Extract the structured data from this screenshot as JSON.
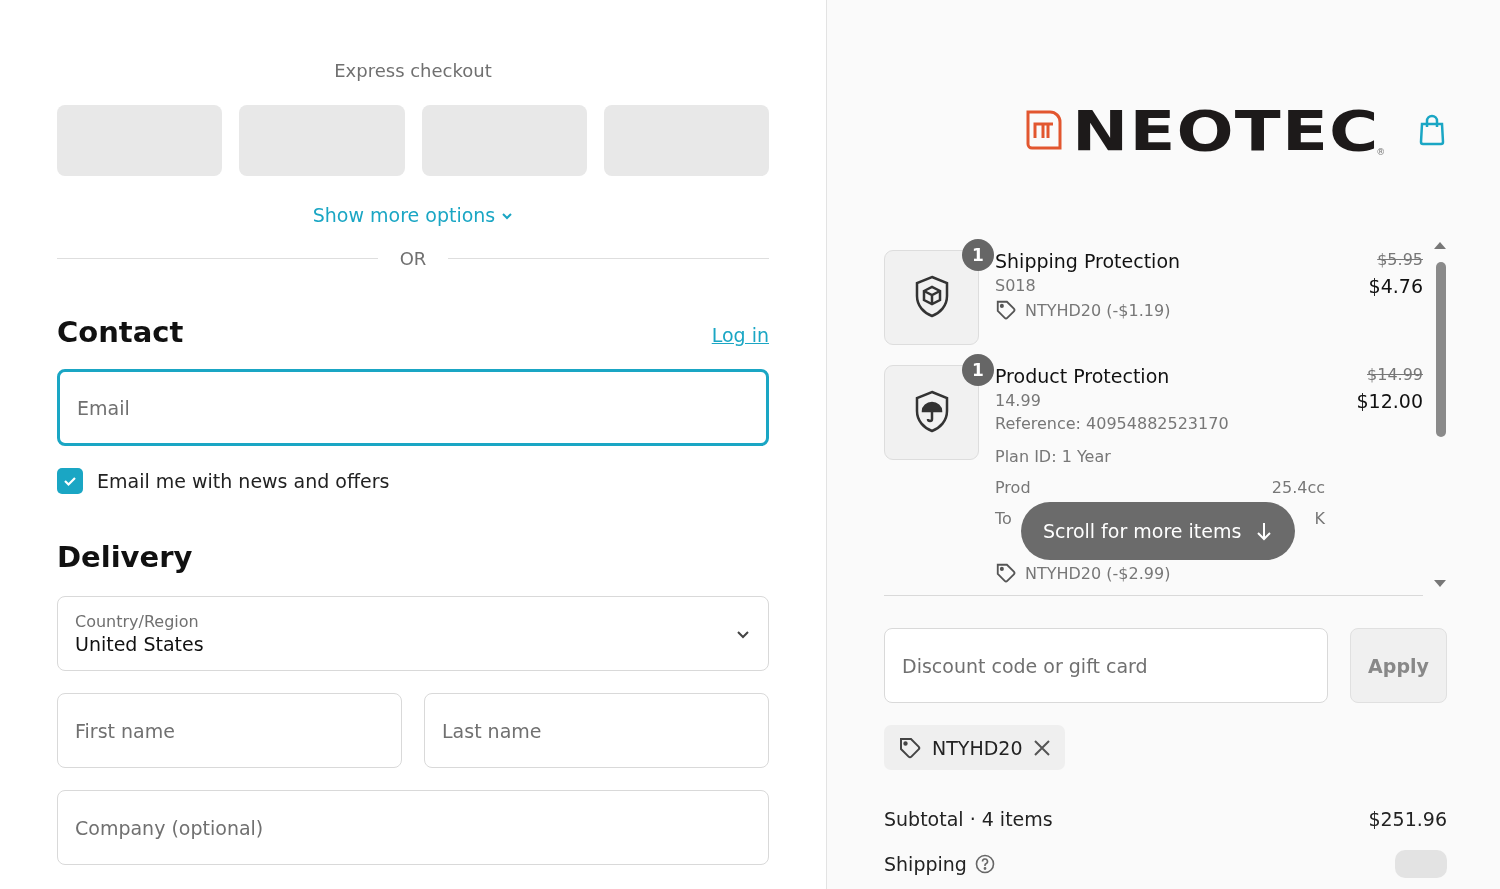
{
  "express": {
    "title": "Express checkout",
    "more": "Show more options",
    "divider": "OR"
  },
  "contact": {
    "title": "Contact",
    "login": "Log in",
    "email": {
      "placeholder": "Email",
      "focused": true
    },
    "newsletter": {
      "label": "Email me with news and offers",
      "checked": true
    }
  },
  "delivery": {
    "title": "Delivery",
    "country": {
      "label": "Country/Region",
      "value": "United States"
    },
    "first_name": {
      "placeholder": "First name"
    },
    "last_name": {
      "placeholder": "Last name"
    },
    "company": {
      "placeholder": "Company (optional)"
    }
  },
  "logo": {
    "text": "NEOTEC",
    "mark": "®"
  },
  "items": [
    {
      "kind": "shipping",
      "quantity": "1",
      "name": "Shipping Protection",
      "lines": [
        "S018"
      ],
      "discount": "NTYHD20 (-$1.19)",
      "old_price": "$5.95",
      "price": "$4.76"
    },
    {
      "kind": "product",
      "quantity": "1",
      "name": "Product Protection",
      "lines": [
        "14.99",
        "Reference: 40954882523170",
        "Plan ID: 1 Year"
      ],
      "cut_lines": [
        {
          "start": "Prod",
          "end": "25.4cc"
        },
        {
          "start": "To",
          "end": "K"
        }
      ],
      "discount": "NTYHD20 (-$2.99)",
      "old_price": "$14.99",
      "price": "$12.00"
    }
  ],
  "scroll_hint": "Scroll for more items",
  "discount": {
    "placeholder": "Discount code or gift card",
    "apply": "Apply",
    "applied": [
      {
        "code": "NTYHD20"
      }
    ]
  },
  "summary": {
    "subtotal_label": "Subtotal · 4 items",
    "subtotal": "$251.96",
    "shipping_label": "Shipping",
    "shipping_loading": true
  }
}
